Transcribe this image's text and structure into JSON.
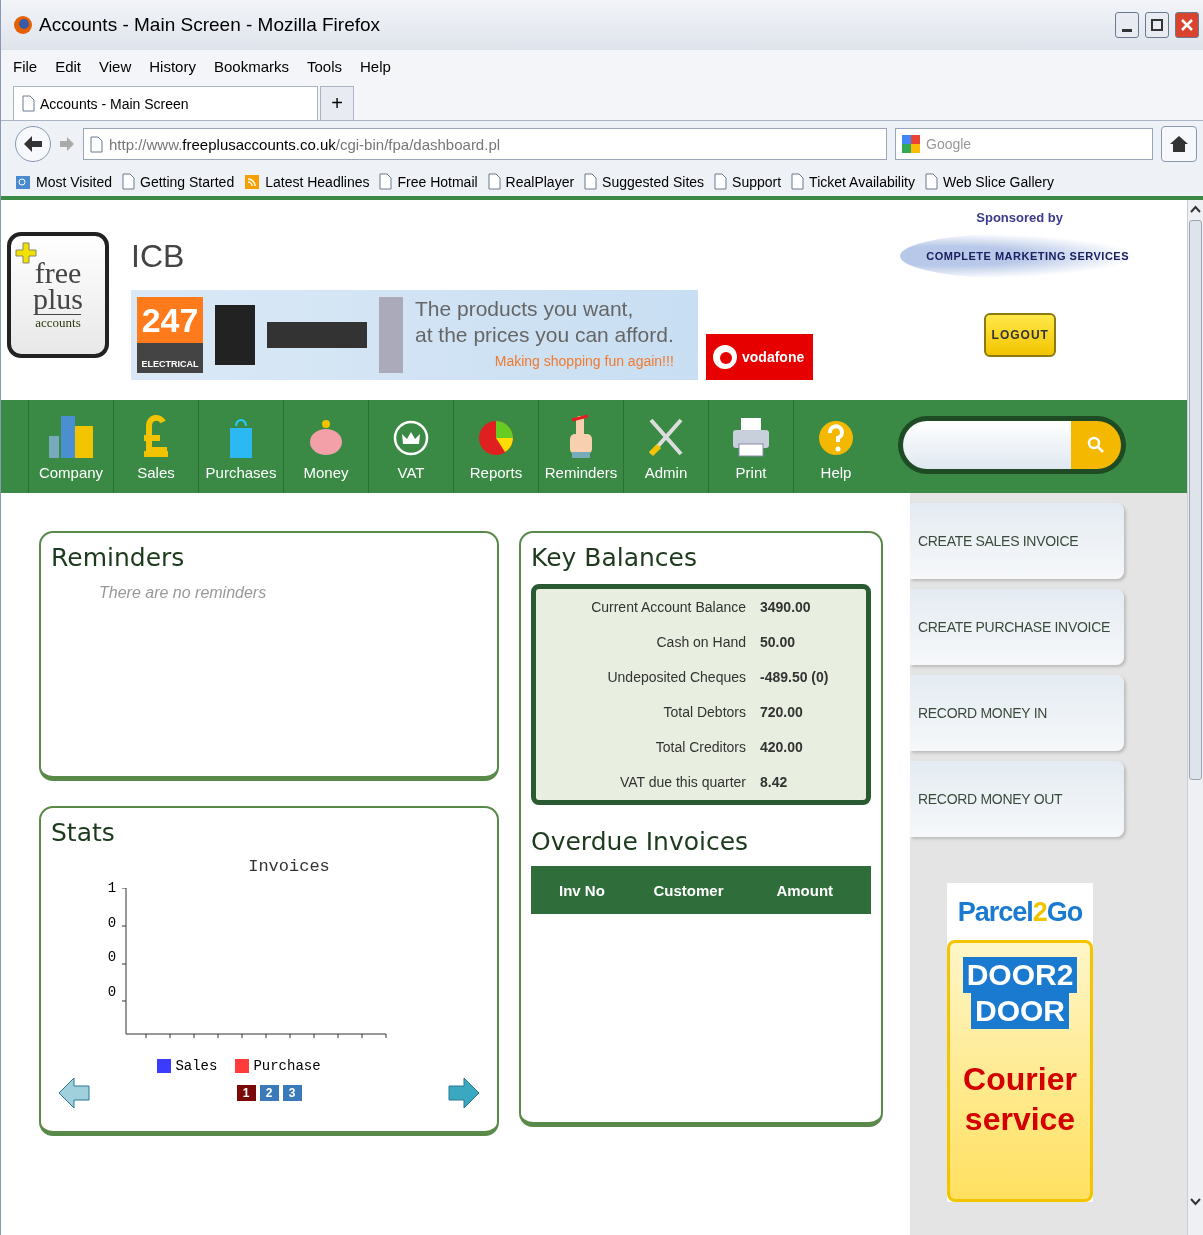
{
  "window": {
    "title": "Accounts - Main Screen - Mozilla Firefox"
  },
  "menu": [
    "File",
    "Edit",
    "View",
    "History",
    "Bookmarks",
    "Tools",
    "Help"
  ],
  "tabs": [
    {
      "label": "Accounts - Main Screen",
      "selected": true
    }
  ],
  "new_tab": "+",
  "address": {
    "prefix": "http://www.",
    "domain": "freeplusaccounts.co.uk",
    "path": "/cgi-bin/fpa/dashboard.pl"
  },
  "search_engine": {
    "placeholder": "Google"
  },
  "bookmarks": [
    {
      "label": "Most Visited",
      "kind": "folder"
    },
    {
      "label": "Getting Started",
      "kind": "page"
    },
    {
      "label": "Latest Headlines",
      "kind": "feed"
    },
    {
      "label": "Free Hotmail",
      "kind": "page"
    },
    {
      "label": "RealPlayer",
      "kind": "page"
    },
    {
      "label": "Suggested Sites",
      "kind": "page"
    },
    {
      "label": "Support",
      "kind": "page"
    },
    {
      "label": "Ticket Availability",
      "kind": "page"
    },
    {
      "label": "Web Slice Gallery",
      "kind": "page"
    }
  ],
  "logo": {
    "line1": "free",
    "line2": "plus",
    "line3": "accounts"
  },
  "company": "ICB",
  "banner": {
    "badge": "247",
    "badge_sub": "ELECTRICAL",
    "line1": "The products you want,",
    "line2": "at the prices you can afford.",
    "tagline": "Making shopping fun again!!!"
  },
  "vodafone": "vodafone",
  "sponsor": {
    "label": "Sponsored by",
    "name": "COMPLETE MARKETING SERVICES"
  },
  "logout": "LOGOUT",
  "nav": [
    "Company",
    "Sales",
    "Purchases",
    "Money",
    "VAT",
    "Reports",
    "Reminders",
    "Admin",
    "Print",
    "Help"
  ],
  "reminders": {
    "title": "Reminders",
    "empty": "There are no reminders"
  },
  "stats": {
    "title": "Stats",
    "chart_title": "Invoices",
    "y_tick_labels": [
      "1",
      "0",
      "0",
      "0"
    ],
    "legend": [
      {
        "label": "Sales",
        "color": "#3b3bff"
      },
      {
        "label": "Purchase",
        "color": "#ff3b3b"
      }
    ],
    "pages": [
      {
        "label": "1",
        "selected": true
      },
      {
        "label": "2",
        "selected": false
      },
      {
        "label": "3",
        "selected": false
      }
    ]
  },
  "key_balances": {
    "title": "Key Balances",
    "rows": [
      {
        "label": "Current Account Balance",
        "value": "3490.00"
      },
      {
        "label": "Cash on Hand",
        "value": "50.00"
      },
      {
        "label": "Undeposited Cheques",
        "value": "-489.50 (0)"
      },
      {
        "label": "Total Debtors",
        "value": "720.00"
      },
      {
        "label": "Total Creditors",
        "value": "420.00"
      },
      {
        "label": "VAT due this quarter",
        "value": "8.42"
      }
    ]
  },
  "overdue": {
    "title": "Overdue Invoices",
    "columns": [
      "Inv No",
      "Customer",
      "Amount"
    ]
  },
  "actions": [
    "CREATE SALES INVOICE",
    "CREATE PURCHASE INVOICE",
    "RECORD MONEY IN",
    "RECORD MONEY OUT"
  ],
  "parcel_ad": {
    "brand_a": "Parcel",
    "brand_num": "2",
    "brand_b": "Go",
    "line1": "DOOR2",
    "line2": "DOOR",
    "line3": "Courier",
    "line4": "service"
  }
}
